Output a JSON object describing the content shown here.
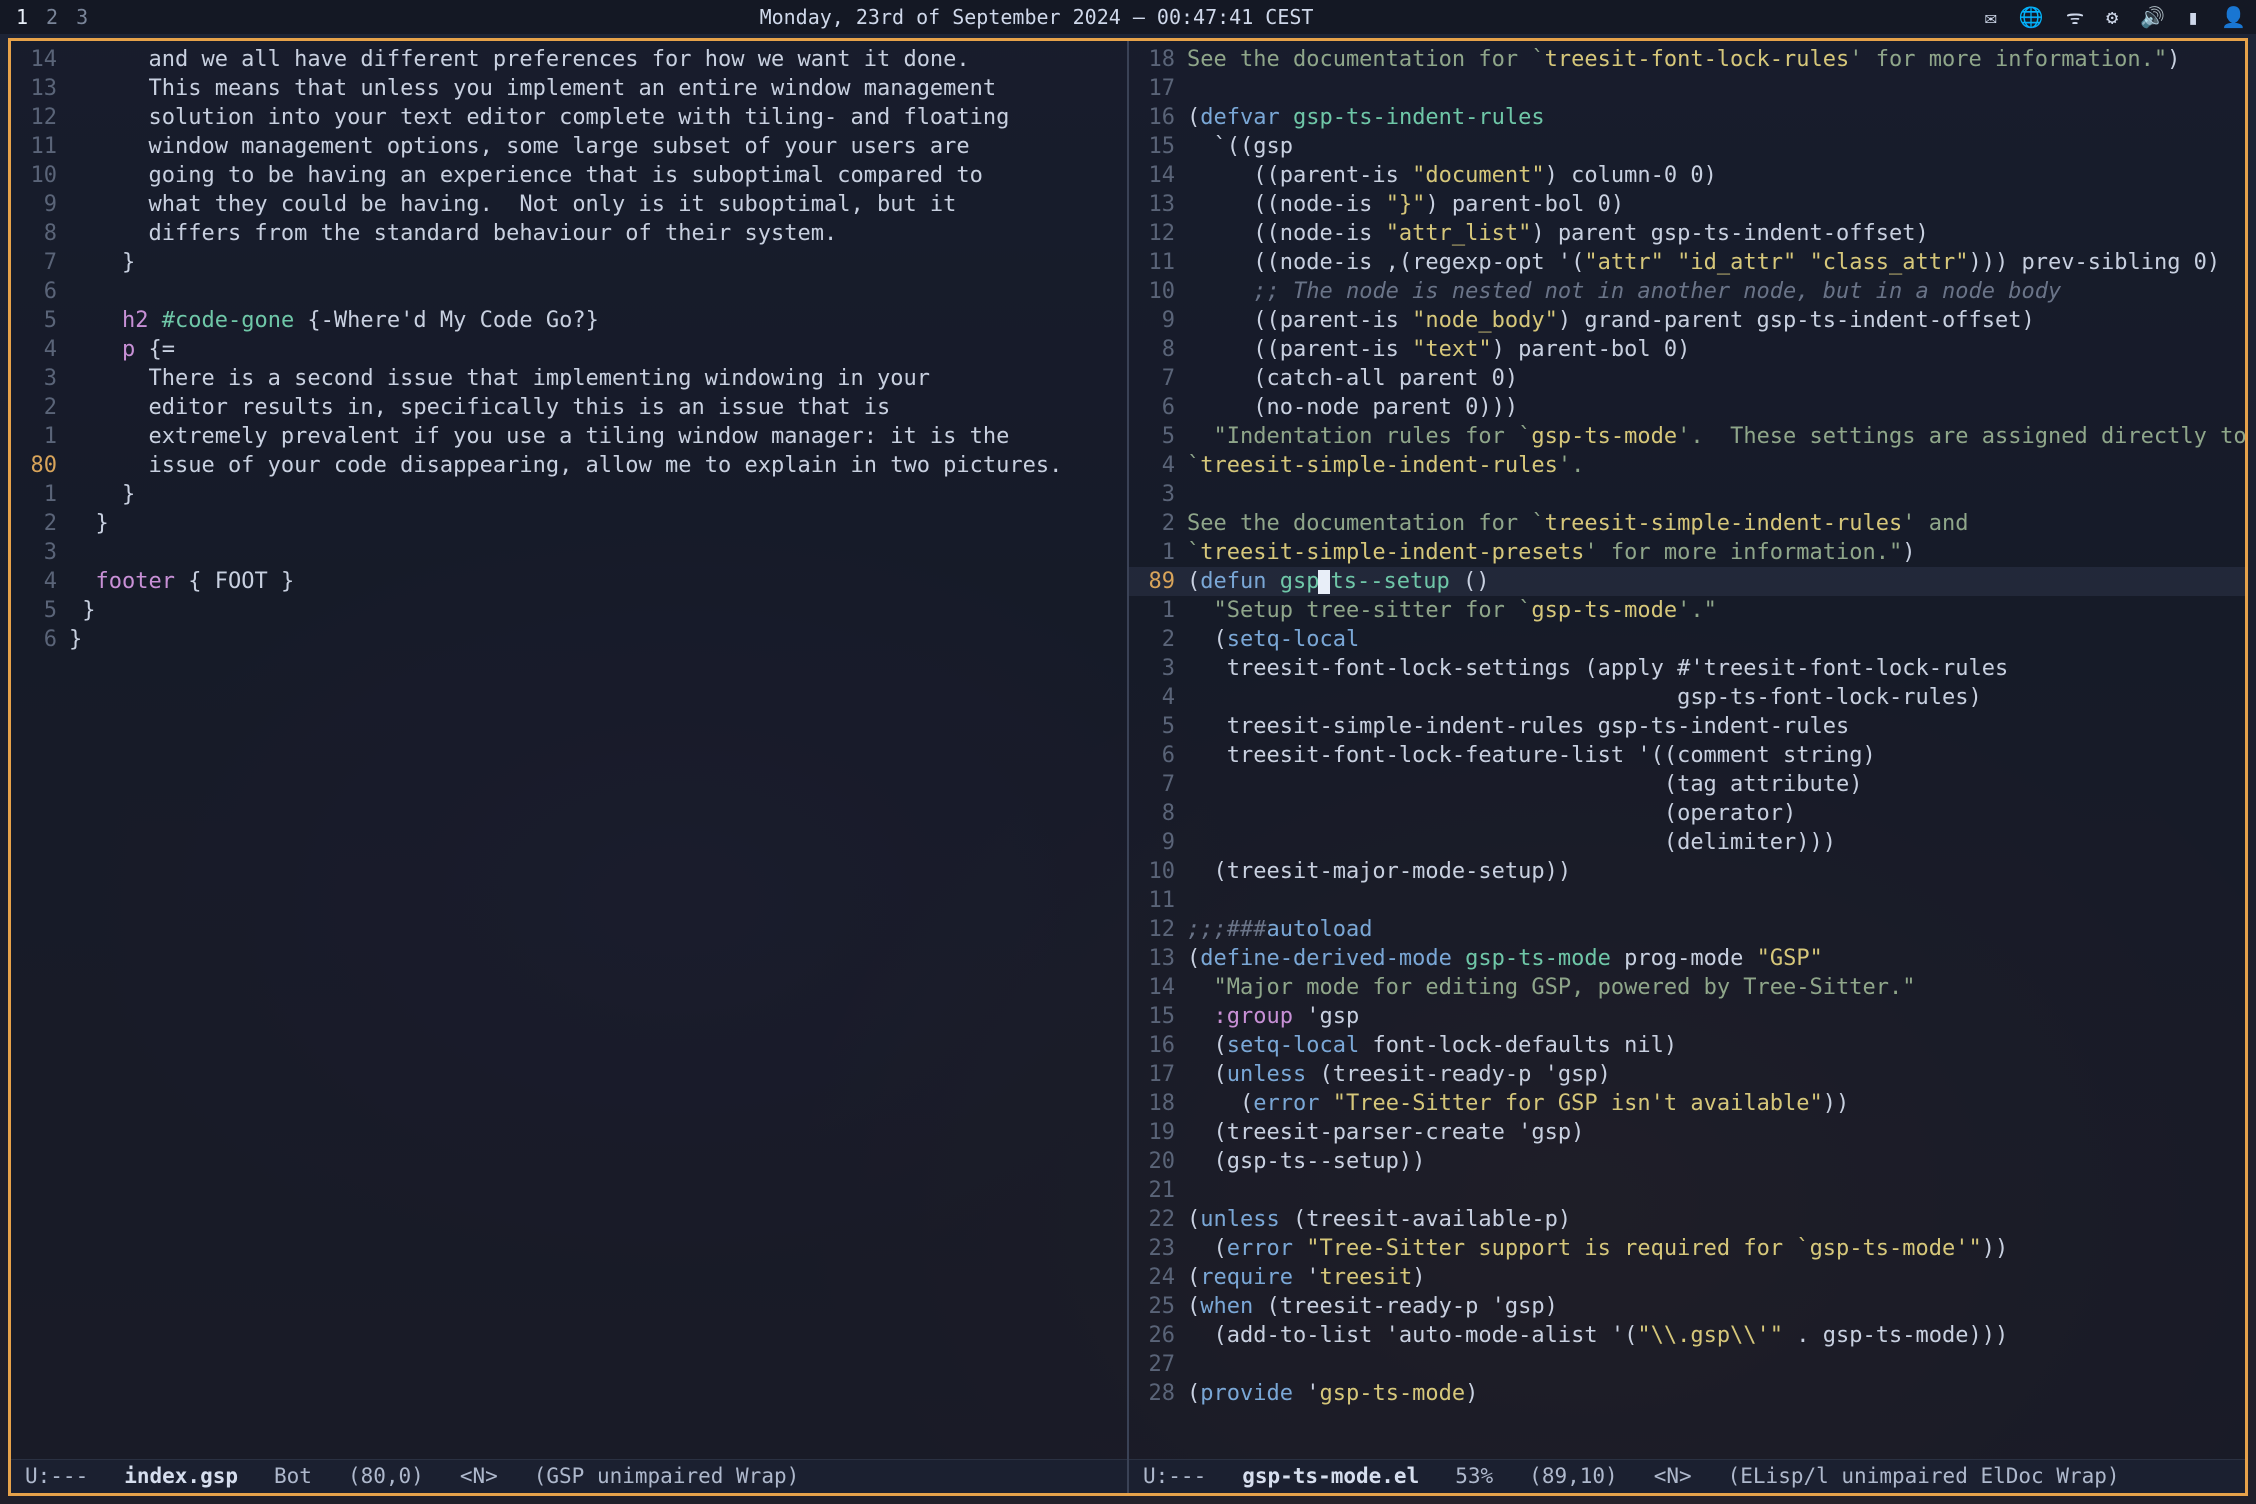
{
  "topbar": {
    "workspaces": [
      "1",
      "2",
      "3"
    ],
    "active_workspace": 0,
    "datetime": "Monday, 23rd of September 2024 — 00:47:41 CEST",
    "tray": {
      "mail": "✉",
      "globe": "🌐",
      "wifi": "ᯤ",
      "gear": "⚙",
      "volume": "🔊",
      "battery": "▮",
      "user": "👤"
    }
  },
  "left": {
    "abs_lineno": "80",
    "modeline": {
      "status": "U:---",
      "filename": "index.gsp",
      "pos": "Bot",
      "coords": "(80,0)",
      "state": "<N>",
      "modes": "(GSP unimpaired Wrap)"
    },
    "lines": [
      {
        "rel": "14",
        "text": "      and we all have different preferences for how we want it done."
      },
      {
        "rel": "13",
        "text": "      This means that unless you implement an entire window management"
      },
      {
        "rel": "12",
        "text": "      solution into your text editor complete with tiling- and floating"
      },
      {
        "rel": "11",
        "text": "      window management options, some large subset of your users are"
      },
      {
        "rel": "10",
        "text": "      going to be having an experience that is suboptimal compared to"
      },
      {
        "rel": "9",
        "text": "      what they could be having.  Not only is it suboptimal, but it"
      },
      {
        "rel": "8",
        "text": "      differs from the standard behaviour of their system."
      },
      {
        "rel": "7",
        "text": "    }"
      },
      {
        "rel": "6",
        "text": ""
      },
      {
        "rel": "5",
        "html": "    <span class='c-tag'>h2</span> <span class='c-id'>#code-gone</span> {-Where'd My Code Go?}"
      },
      {
        "rel": "4",
        "html": "    <span class='c-tag'>p</span> {="
      },
      {
        "rel": "3",
        "text": "      There is a second issue that implementing windowing in your"
      },
      {
        "rel": "2",
        "text": "      editor results in, specifically this is an issue that is"
      },
      {
        "rel": "1",
        "text": "      extremely prevalent if you use a tiling window manager: it is the"
      },
      {
        "rel": "80",
        "abs": true,
        "text": "      issue of your code disappearing, allow me to explain in two pictures.",
        "cursor_after_gutter": true
      },
      {
        "rel": "1",
        "text": "    }"
      },
      {
        "rel": "2",
        "text": "  }"
      },
      {
        "rel": "3",
        "text": ""
      },
      {
        "rel": "4",
        "html": "  <span class='c-tag'>footer</span> { FOOT }"
      },
      {
        "rel": "5",
        "text": " }"
      },
      {
        "rel": "6",
        "text": "}"
      }
    ]
  },
  "right": {
    "abs_lineno": "89",
    "modeline": {
      "status": "U:---",
      "filename": "gsp-ts-mode.el",
      "pos": "53%",
      "coords": "(89,10)",
      "state": "<N>",
      "modes": "(ELisp/l unimpaired ElDoc Wrap)"
    },
    "lines": [
      {
        "rel": "18",
        "html": "<span class='c-doc'>See the documentation for `</span><span class='c-quote'>treesit-font-lock-rules</span><span class='c-doc'>' for more information.\"</span>)"
      },
      {
        "rel": "17",
        "text": ""
      },
      {
        "rel": "16",
        "html": "(<span class='c-kw'>defvar</span> <span class='c-fn'>gsp-ts-indent-rules</span>"
      },
      {
        "rel": "15",
        "html": "  `((gsp"
      },
      {
        "rel": "14",
        "html": "     ((parent-is <span class='c-str'>\"document\"</span>) column-0 0)"
      },
      {
        "rel": "13",
        "html": "     ((node-is <span class='c-str'>\"}\"</span>) parent-bol 0)"
      },
      {
        "rel": "12",
        "html": "     ((node-is <span class='c-str'>\"attr_list\"</span>) parent gsp-ts-indent-offset)"
      },
      {
        "rel": "11",
        "html": "     ((node-is ,(regexp-opt '(<span class='c-str'>\"attr\"</span> <span class='c-str'>\"id_attr\"</span> <span class='c-str'>\"class_attr\"</span>))) prev-sibling 0)"
      },
      {
        "rel": "10",
        "html": "     <span class='c-cmt'>;; The node is nested not in another node, but in a node body</span>"
      },
      {
        "rel": "9",
        "html": "     ((parent-is <span class='c-str'>\"node_body\"</span>) grand-parent gsp-ts-indent-offset)"
      },
      {
        "rel": "8",
        "html": "     ((parent-is <span class='c-str'>\"text\"</span>) parent-bol 0)"
      },
      {
        "rel": "7",
        "html": "     (catch-all parent 0)"
      },
      {
        "rel": "6",
        "html": "     (no-node parent 0)))"
      },
      {
        "rel": "5",
        "html": "  <span class='c-doc'>\"Indentation rules for `</span><span class='c-quote'>gsp-ts-mode</span><span class='c-doc'>'.  These settings are assigned directly to</span>"
      },
      {
        "rel": "4",
        "html": "<span class='c-doc'>`</span><span class='c-quote'>treesit-simple-indent-rules</span><span class='c-doc'>'.</span>"
      },
      {
        "rel": "3",
        "text": ""
      },
      {
        "rel": "2",
        "html": "<span class='c-doc'>See the documentation for `</span><span class='c-quote'>treesit-simple-indent-rules</span><span class='c-doc'>' and</span>"
      },
      {
        "rel": "1",
        "html": "<span class='c-doc'>`</span><span class='c-quote'>treesit-simple-indent-presets</span><span class='c-doc'>' for more information.\"</span>)"
      },
      {
        "rel": "89",
        "abs": true,
        "hl": true,
        "html": "(<span class='c-kw'>defun</span> <span class='c-fn'>gsp</span><span class='cursor'></span><span class='c-fn'>ts--setup</span> ()"
      },
      {
        "rel": "1",
        "html": "  <span class='c-doc'>\"Setup tree-sitter for `</span><span class='c-quote'>gsp-ts-mode</span><span class='c-doc'>'.\"</span>"
      },
      {
        "rel": "2",
        "html": "  (<span class='c-kw'>setq-local</span>"
      },
      {
        "rel": "3",
        "html": "   treesit-font-lock-settings (apply #'treesit-font-lock-rules"
      },
      {
        "rel": "4",
        "html": "                                     gsp-ts-font-lock-rules)"
      },
      {
        "rel": "5",
        "html": "   treesit-simple-indent-rules gsp-ts-indent-rules"
      },
      {
        "rel": "6",
        "html": "   treesit-font-lock-feature-list '((comment string)"
      },
      {
        "rel": "7",
        "html": "                                    (tag attribute)"
      },
      {
        "rel": "8",
        "html": "                                    (operator)"
      },
      {
        "rel": "9",
        "html": "                                    (delimiter)))"
      },
      {
        "rel": "10",
        "html": "  (treesit-major-mode-setup))"
      },
      {
        "rel": "11",
        "text": ""
      },
      {
        "rel": "12",
        "html": "<span class='c-cmt'>;;;###</span><span class='c-kw'>autoload</span>"
      },
      {
        "rel": "13",
        "html": "(<span class='c-kw'>define-derived-mode</span> <span class='c-fn'>gsp-ts-mode</span> prog-mode <span class='c-str'>\"GSP\"</span>"
      },
      {
        "rel": "14",
        "html": "  <span class='c-doc'>\"Major mode for editing GSP, powered by Tree-Sitter.\"</span>"
      },
      {
        "rel": "15",
        "html": "  <span class='c-const'>:group</span> 'gsp"
      },
      {
        "rel": "16",
        "html": "  (<span class='c-kw'>setq-local</span> font-lock-defaults nil)"
      },
      {
        "rel": "17",
        "html": "  (<span class='c-kw'>unless</span> (treesit-ready-p 'gsp)"
      },
      {
        "rel": "18",
        "html": "    (<span class='c-kw'>error</span> <span class='c-str'>\"Tree-Sitter for GSP isn't available\"</span>))"
      },
      {
        "rel": "19",
        "html": "  (treesit-parser-create 'gsp)"
      },
      {
        "rel": "20",
        "html": "  (gsp-ts--setup))"
      },
      {
        "rel": "21",
        "text": ""
      },
      {
        "rel": "22",
        "html": "(<span class='c-kw'>unless</span> (treesit-available-p)"
      },
      {
        "rel": "23",
        "html": "  (<span class='c-kw'>error</span> <span class='c-str'>\"Tree-Sitter support is required for `</span><span class='c-quote'>gsp-ts-mode</span><span class='c-str'>'\"</span>))"
      },
      {
        "rel": "24",
        "html": "(<span class='c-kw'>require</span> '<span class='c-quote'>treesit</span>)"
      },
      {
        "rel": "25",
        "html": "(<span class='c-kw'>when</span> (treesit-ready-p 'gsp)"
      },
      {
        "rel": "26",
        "html": "  (add-to-list 'auto-mode-alist '(<span class='c-str'>\"\\\\.gsp\\\\'\"</span> . gsp-ts-mode)))"
      },
      {
        "rel": "27",
        "text": ""
      },
      {
        "rel": "28",
        "html": "(<span class='c-kw'>provide</span> '<span class='c-quote'>gsp-ts-mode</span>)"
      }
    ]
  }
}
